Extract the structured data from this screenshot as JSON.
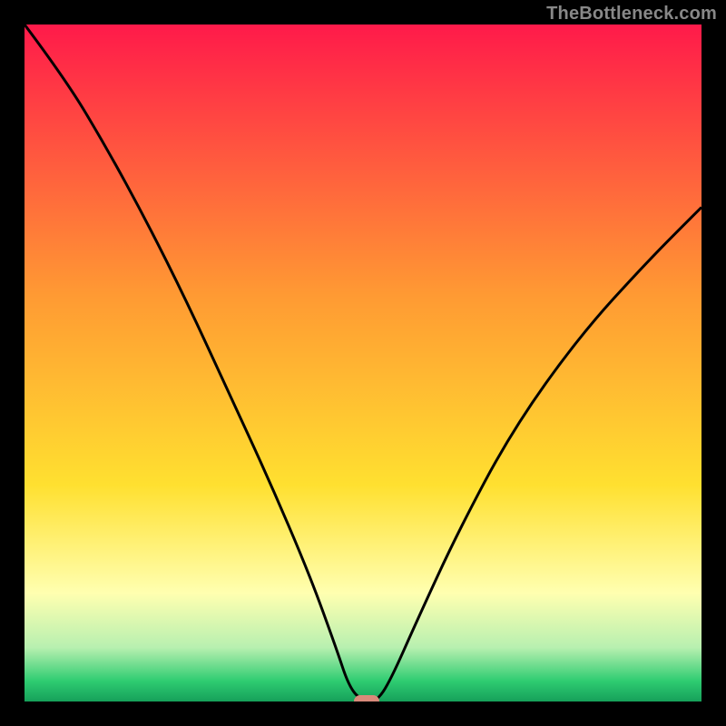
{
  "watermark": "TheBottleneck.com",
  "colors": {
    "bg_black": "#000000",
    "top_red": "#ff1a4a",
    "mid_orange": "#ff9a33",
    "mid_yellow": "#ffe030",
    "pale_yellow": "#ffffb0",
    "pale_green": "#b8f0b0",
    "green": "#2ecc71",
    "deep_green": "#16a05a",
    "curve": "#000000",
    "marker": "#d98a7a",
    "watermark_text": "#888888"
  },
  "chart_data": {
    "type": "line",
    "title": "",
    "xlabel": "",
    "ylabel": "",
    "xlim": [
      0,
      100
    ],
    "ylim": [
      0,
      100
    ],
    "series": [
      {
        "name": "bottleneck-curve",
        "x": [
          0,
          6,
          12,
          18,
          24,
          30,
          36,
          42,
          46,
          48,
          50,
          52,
          54,
          58,
          64,
          72,
          82,
          92,
          100
        ],
        "y": [
          100,
          92,
          82,
          71,
          59,
          46,
          33,
          19,
          8,
          2,
          0,
          0,
          3,
          12,
          25,
          40,
          54,
          65,
          73
        ]
      }
    ],
    "marker": {
      "x": 50.5,
      "y": 0
    },
    "gradient_stops": [
      {
        "pct": 0,
        "color": "#ff1a4a"
      },
      {
        "pct": 40,
        "color": "#ff9a33"
      },
      {
        "pct": 68,
        "color": "#ffe030"
      },
      {
        "pct": 84,
        "color": "#ffffb0"
      },
      {
        "pct": 92,
        "color": "#b8f0b0"
      },
      {
        "pct": 97,
        "color": "#2ecc71"
      },
      {
        "pct": 100,
        "color": "#16a05a"
      }
    ]
  }
}
